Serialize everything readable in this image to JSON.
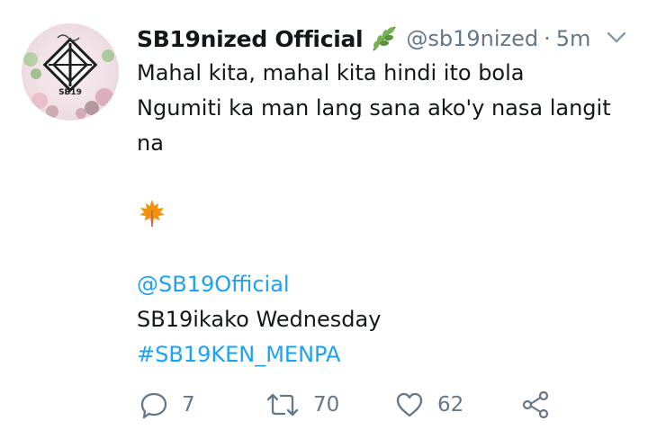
{
  "author": {
    "display_name": "SB19nized Official",
    "badge_emoji": "herb-emoji",
    "handle": "@sb19nized",
    "separator": "·",
    "time": "5m",
    "avatar_text": "SB19"
  },
  "tweet": {
    "line1": "Mahal kita, mahal kita hindi ito bola",
    "line2": "Ngumiti ka man lang sana ako'y nasa langit",
    "line3": "na",
    "emoji": "maple-leaf-emoji",
    "mention": "@SB19Official",
    "line_after_mention": "SB19ikako Wednesday",
    "hashtag": "#SB19KEN_MENPA"
  },
  "actions": {
    "reply_count": "7",
    "retweet_count": "70",
    "like_count": "62"
  },
  "colors": {
    "text": "#14171a",
    "secondary": "#657786",
    "link": "#1da1f2",
    "maple": "#f4900c"
  }
}
